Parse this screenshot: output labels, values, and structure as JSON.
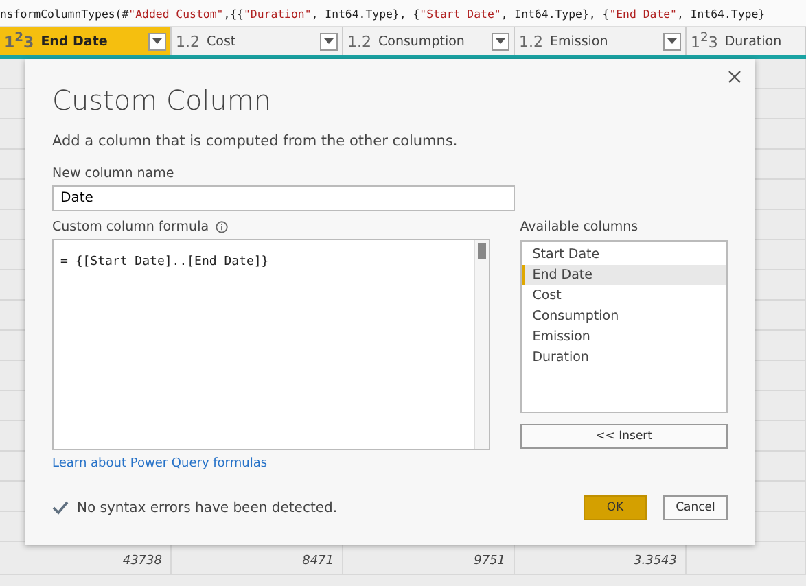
{
  "formula_bar": {
    "segments": [
      {
        "text": "nsformColumnTypes(#",
        "kind": "code"
      },
      {
        "text": "\"Added Custom\"",
        "kind": "string"
      },
      {
        "text": ",{{",
        "kind": "code"
      },
      {
        "text": "\"Duration\"",
        "kind": "string"
      },
      {
        "text": ", Int64.Type}, {",
        "kind": "code"
      },
      {
        "text": "\"Start Date\"",
        "kind": "string"
      },
      {
        "text": ", Int64.Type}, {",
        "kind": "code"
      },
      {
        "text": "\"End Date\"",
        "kind": "string"
      },
      {
        "text": ", Int64.Type}",
        "kind": "code"
      }
    ]
  },
  "columns": [
    {
      "type": "1$^{2}$3",
      "name": "End Date",
      "selected": true
    },
    {
      "type": "1.2",
      "name": "Cost",
      "selected": false
    },
    {
      "type": "1.2",
      "name": "Consumption",
      "selected": false
    },
    {
      "type": "1.2",
      "name": "Emission",
      "selected": false
    },
    {
      "type": "1$^{2}$3",
      "name": "Duration",
      "selected": false
    }
  ],
  "grid_row": [
    "43738",
    "8471",
    "9751",
    "3.3543"
  ],
  "dialog": {
    "title": "Custom Column",
    "description": "Add a column that is computed from the other columns.",
    "name_label": "New column name",
    "name_value": "Date",
    "formula_label": "Custom column formula",
    "formula_value": "= {[Start Date]..[End Date]}",
    "available_label": "Available columns",
    "available": [
      {
        "name": "Start Date",
        "selected": false
      },
      {
        "name": "End Date",
        "selected": true
      },
      {
        "name": "Cost",
        "selected": false
      },
      {
        "name": "Consumption",
        "selected": false
      },
      {
        "name": "Emission",
        "selected": false
      },
      {
        "name": "Duration",
        "selected": false
      }
    ],
    "insert_button": "<< Insert",
    "learn_link": "Learn about Power Query formulas",
    "status": "No syntax errors have been detected.",
    "ok_button": "OK",
    "cancel_button": "Cancel"
  }
}
